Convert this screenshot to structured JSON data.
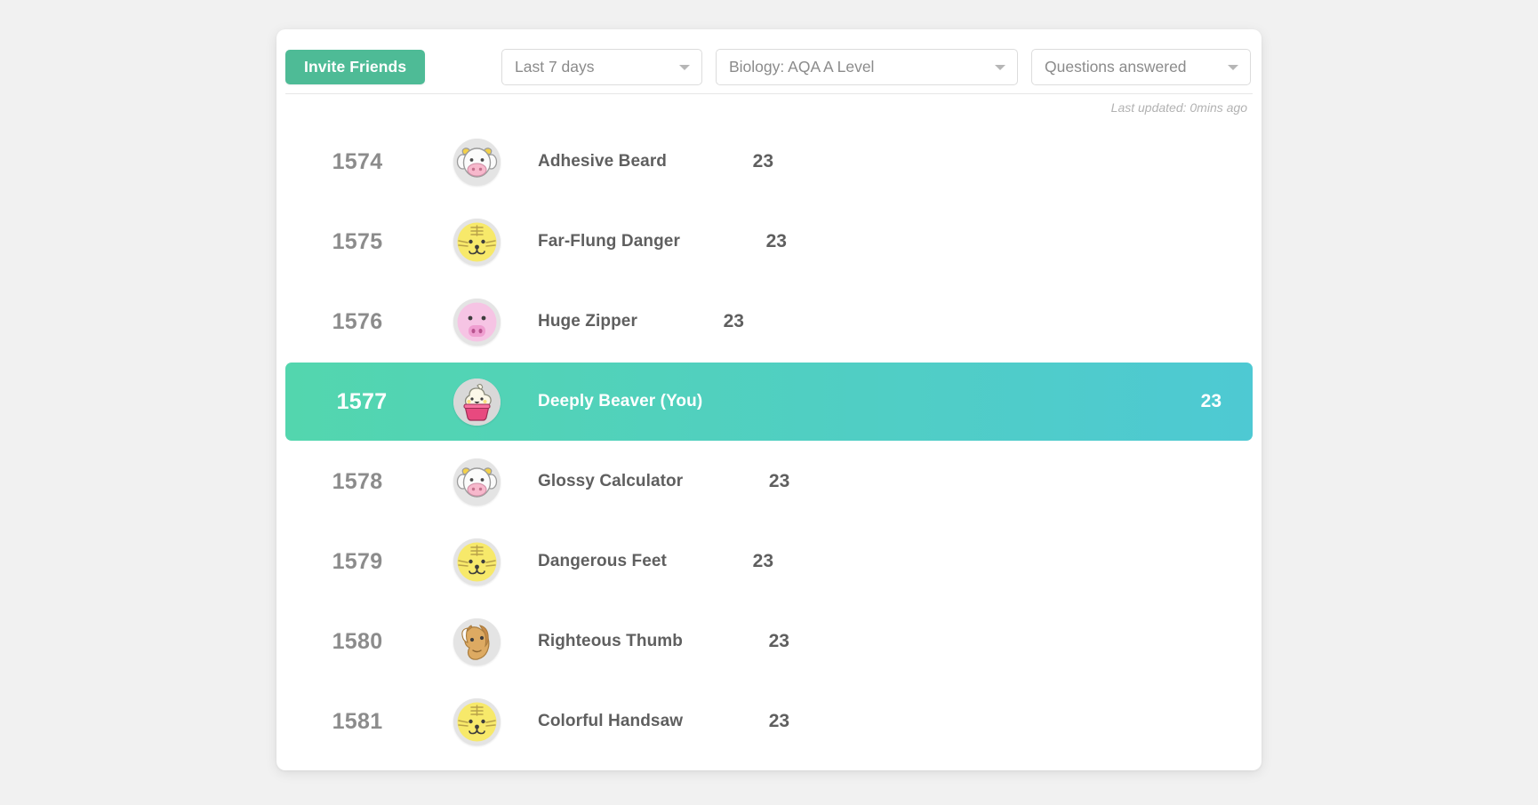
{
  "toolbar": {
    "invite_label": "Invite Friends",
    "selects": [
      {
        "id": "period",
        "name": "period-filter-select",
        "value": "Last 7 days"
      },
      {
        "id": "subject",
        "name": "subject-filter-select",
        "value": "Biology: AQA A Level"
      },
      {
        "id": "metric",
        "name": "metric-filter-select",
        "value": "Questions answered"
      }
    ]
  },
  "status": {
    "last_updated": "Last updated: 0mins ago"
  },
  "colors": {
    "accent_green": "#4ebb96",
    "highlight_gradient_start": "#53d6ae",
    "highlight_gradient_end": "#4ec9d3",
    "rank_text": "#8c8c8c",
    "name_text": "#5f5f5f",
    "page_background": "#f1f1f1",
    "card_background": "#ffffff"
  },
  "leaderboard": {
    "rows": [
      {
        "rank": "1574",
        "name": "Adhesive Beard",
        "score": "23",
        "avatar": "cow-avatar",
        "is_you": false
      },
      {
        "rank": "1575",
        "name": "Far-Flung Danger",
        "score": "23",
        "avatar": "tiger-avatar",
        "is_you": false
      },
      {
        "rank": "1576",
        "name": "Huge Zipper",
        "score": "23",
        "avatar": "pig-avatar",
        "is_you": false
      },
      {
        "rank": "1577",
        "name": "Deeply Beaver (You)",
        "score": "23",
        "avatar": "cupcake-avatar",
        "is_you": true
      },
      {
        "rank": "1578",
        "name": "Glossy Calculator",
        "score": "23",
        "avatar": "cow-avatar",
        "is_you": false
      },
      {
        "rank": "1579",
        "name": "Dangerous Feet",
        "score": "23",
        "avatar": "tiger-avatar",
        "is_you": false
      },
      {
        "rank": "1580",
        "name": "Righteous Thumb",
        "score": "23",
        "avatar": "horse-avatar",
        "is_you": false
      },
      {
        "rank": "1581",
        "name": "Colorful Handsaw",
        "score": "23",
        "avatar": "tiger-avatar",
        "is_you": false
      }
    ]
  }
}
